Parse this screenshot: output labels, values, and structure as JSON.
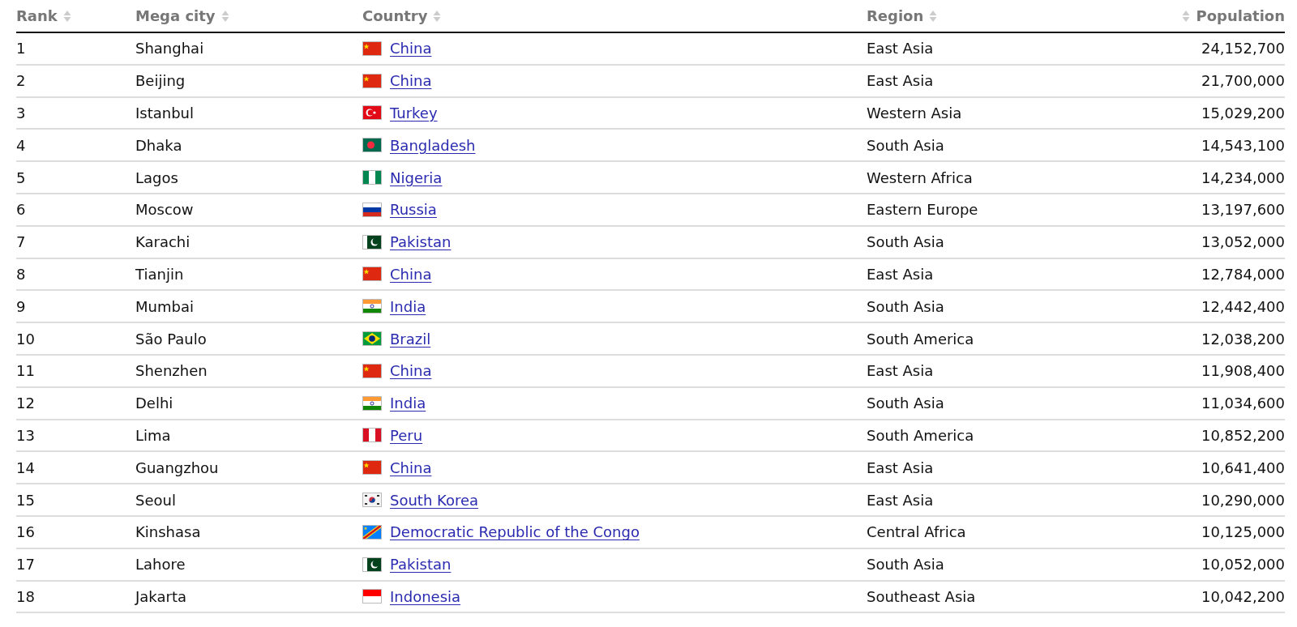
{
  "table": {
    "columns": [
      {
        "label": "Rank"
      },
      {
        "label": "Mega city"
      },
      {
        "label": "Country"
      },
      {
        "label": "Region"
      },
      {
        "label": "Population"
      }
    ],
    "rows": [
      {
        "rank": "1",
        "city": "Shanghai",
        "kind": "cn",
        "country": "China",
        "region": "East Asia",
        "population": "24,152,700"
      },
      {
        "rank": "2",
        "city": "Beijing",
        "kind": "cn",
        "country": "China",
        "region": "East Asia",
        "population": "21,700,000"
      },
      {
        "rank": "3",
        "city": "Istanbul",
        "kind": "tr",
        "country": "Turkey",
        "region": "Western Asia",
        "population": "15,029,200"
      },
      {
        "rank": "4",
        "city": "Dhaka",
        "kind": "bd",
        "country": "Bangladesh",
        "region": "South Asia",
        "population": "14,543,100"
      },
      {
        "rank": "5",
        "city": "Lagos",
        "kind": "ng",
        "country": "Nigeria",
        "region": "Western Africa",
        "population": "14,234,000"
      },
      {
        "rank": "6",
        "city": "Moscow",
        "kind": "ru",
        "country": "Russia",
        "region": "Eastern Europe",
        "population": "13,197,600"
      },
      {
        "rank": "7",
        "city": "Karachi",
        "kind": "pk",
        "country": "Pakistan",
        "region": "South Asia",
        "population": "13,052,000"
      },
      {
        "rank": "8",
        "city": "Tianjin",
        "kind": "cn",
        "country": "China",
        "region": "East Asia",
        "population": "12,784,000"
      },
      {
        "rank": "9",
        "city": "Mumbai",
        "kind": "in",
        "country": "India",
        "region": "South Asia",
        "population": "12,442,400"
      },
      {
        "rank": "10",
        "city": "São Paulo",
        "kind": "br",
        "country": "Brazil",
        "region": "South America",
        "population": "12,038,200"
      },
      {
        "rank": "11",
        "city": "Shenzhen",
        "kind": "cn",
        "country": "China",
        "region": "East Asia",
        "population": "11,908,400"
      },
      {
        "rank": "12",
        "city": "Delhi",
        "kind": "in",
        "country": "India",
        "region": "South Asia",
        "population": "11,034,600"
      },
      {
        "rank": "13",
        "city": "Lima",
        "kind": "pe",
        "country": "Peru",
        "region": "South America",
        "population": "10,852,200"
      },
      {
        "rank": "14",
        "city": "Guangzhou",
        "kind": "cn",
        "country": "China",
        "region": "East Asia",
        "population": "10,641,400"
      },
      {
        "rank": "15",
        "city": "Seoul",
        "kind": "kr",
        "country": "South Korea",
        "region": "East Asia",
        "population": "10,290,000"
      },
      {
        "rank": "16",
        "city": "Kinshasa",
        "kind": "cd",
        "country": "Democratic Republic of the Congo",
        "region": "Central Africa",
        "population": "10,125,000"
      },
      {
        "rank": "17",
        "city": "Lahore",
        "kind": "pk",
        "country": "Pakistan",
        "region": "South Asia",
        "population": "10,052,000"
      },
      {
        "rank": "18",
        "city": "Jakarta",
        "kind": "id",
        "country": "Indonesia",
        "region": "Southeast Asia",
        "population": "10,042,200"
      }
    ]
  }
}
